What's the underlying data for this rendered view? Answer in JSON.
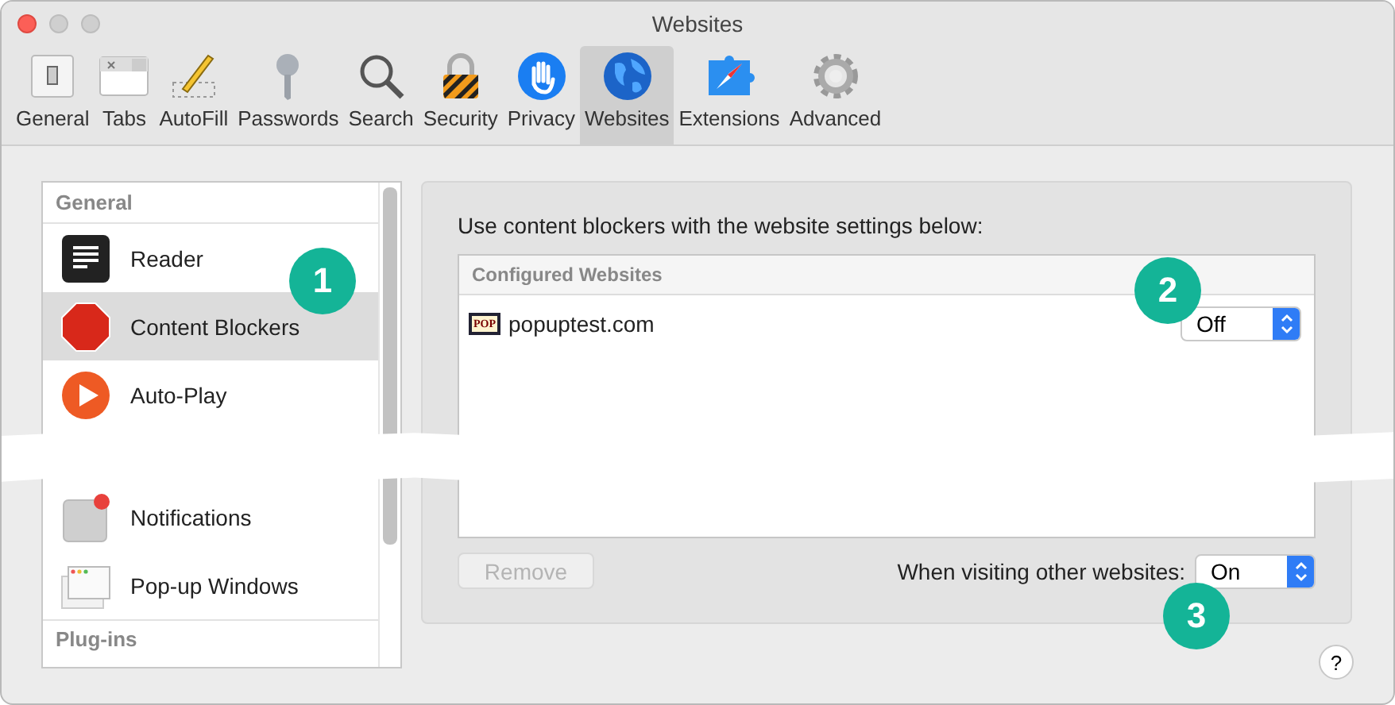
{
  "window": {
    "title": "Websites"
  },
  "toolbar": [
    {
      "label": "General",
      "selected": false
    },
    {
      "label": "Tabs",
      "selected": false
    },
    {
      "label": "AutoFill",
      "selected": false
    },
    {
      "label": "Passwords",
      "selected": false
    },
    {
      "label": "Search",
      "selected": false
    },
    {
      "label": "Security",
      "selected": false
    },
    {
      "label": "Privacy",
      "selected": false
    },
    {
      "label": "Websites",
      "selected": true
    },
    {
      "label": "Extensions",
      "selected": false
    },
    {
      "label": "Advanced",
      "selected": false
    }
  ],
  "sidebar": {
    "sections": [
      {
        "header": "General",
        "items": [
          {
            "label": "Reader",
            "selected": false
          },
          {
            "label": "Content Blockers",
            "selected": true
          },
          {
            "label": "Auto-Play",
            "selected": false
          },
          {
            "label": "Notifications",
            "selected": false
          },
          {
            "label": "Pop-up Windows",
            "selected": false
          }
        ]
      },
      {
        "header": "Plug-ins"
      }
    ]
  },
  "panel": {
    "intro": "Use content blockers with the website settings below:",
    "table": {
      "header": "Configured Websites",
      "rows": [
        {
          "favicon": "POP",
          "site": "popuptest.com",
          "setting": "Off"
        }
      ]
    },
    "remove_button": {
      "label": "Remove",
      "disabled": true
    },
    "other_label": "When visiting other websites:",
    "other_setting": "On"
  },
  "help": "?",
  "callouts": [
    {
      "number": "1"
    },
    {
      "number": "2"
    },
    {
      "number": "3"
    }
  ]
}
